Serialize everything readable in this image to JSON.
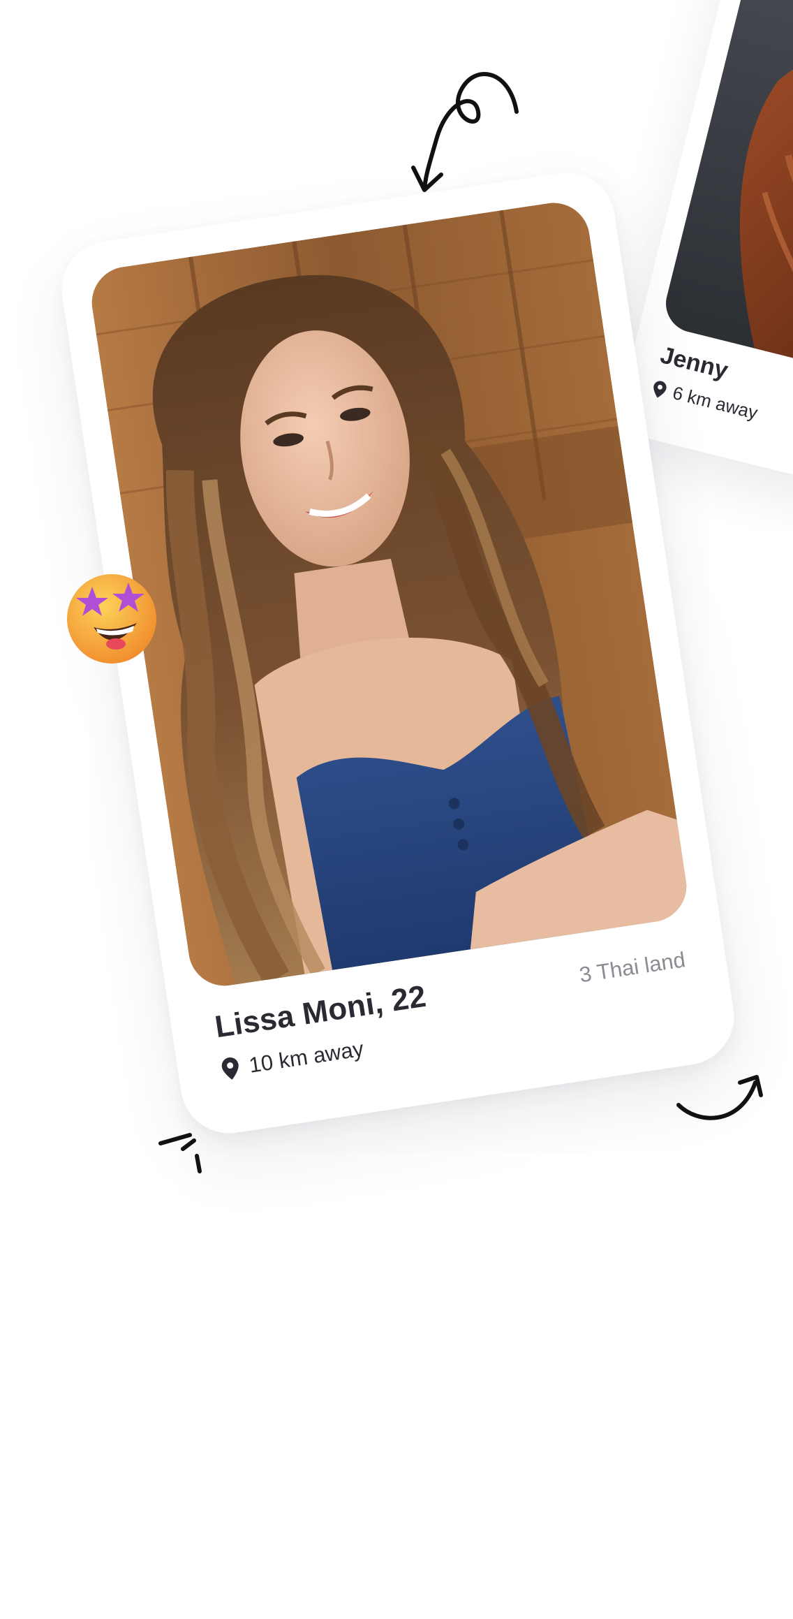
{
  "main_card": {
    "name": "Lissa Moni, 22",
    "distance": "10 km away",
    "country": "3 Thai land",
    "photo_description": "profile-photo"
  },
  "second_card": {
    "name": "Jenny",
    "distance": "6 km away"
  },
  "emoji": {
    "icon": "star-struck-emoji-icon"
  },
  "colors": {
    "background": "#ffffff",
    "card": "#ffffff",
    "text_primary": "#2a2a33",
    "text_secondary": "#8b8b93",
    "emoji_face": "#f7a534",
    "emoji_star": "#b04fd6"
  }
}
